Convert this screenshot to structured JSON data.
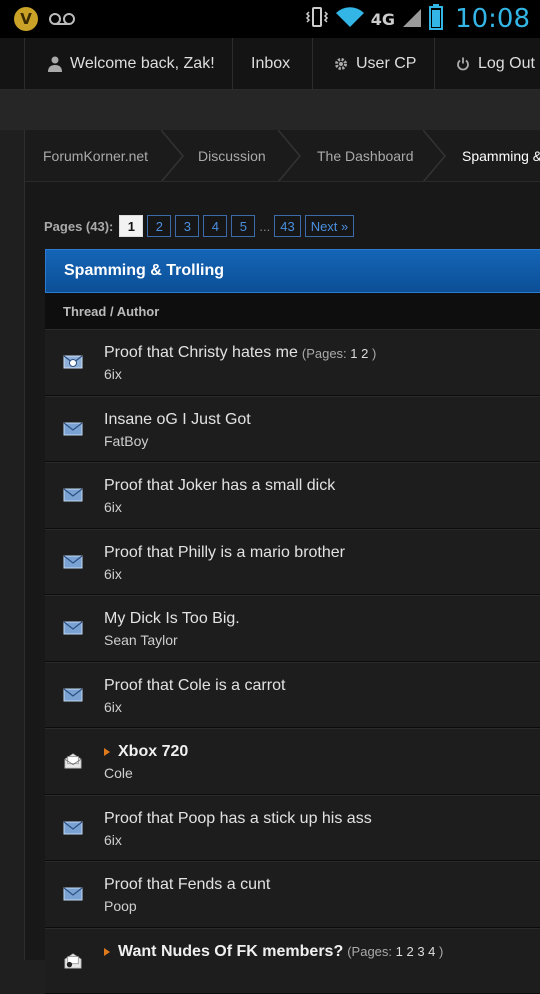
{
  "status_bar": {
    "time": "10:08",
    "network": "4G",
    "icons": [
      "verizon-icon",
      "voicemail-icon",
      "vibrate-icon",
      "wifi-icon",
      "signal-icon",
      "battery-icon"
    ]
  },
  "user_bar": {
    "welcome": "Welcome back, Zak!",
    "inbox": "Inbox",
    "user_cp": "User CP",
    "logout": "Log Out"
  },
  "breadcrumb": [
    "ForumKorner.net",
    "Discussion",
    "The Dashboard",
    "Spamming &"
  ],
  "pagination": {
    "label": "Pages (43):",
    "current": "1",
    "pages": [
      "2",
      "3",
      "4",
      "5"
    ],
    "ellipsis": "...",
    "last": "43",
    "next": "Next »"
  },
  "forum": {
    "title": "Spamming & Trolling",
    "column_header": "Thread / Author"
  },
  "threads": [
    {
      "title": "Proof that Christy hates me",
      "pages_label": "(Pages:",
      "pages": "1 2",
      "pages_close": ")",
      "author": "6ix",
      "icon": "hot-thread-icon",
      "sticky": false
    },
    {
      "title": "Insane oG I Just Got",
      "author": "FatBoy",
      "icon": "envelope-icon",
      "sticky": false
    },
    {
      "title": "Proof that Joker has a small dick",
      "author": "6ix",
      "icon": "envelope-icon",
      "sticky": false
    },
    {
      "title": "Proof that Philly is a mario brother",
      "author": "6ix",
      "icon": "envelope-icon",
      "sticky": false
    },
    {
      "title": "My Dick Is Too Big.",
      "author": "Sean Taylor",
      "icon": "envelope-icon",
      "sticky": false
    },
    {
      "title": "Proof that Cole is a carrot",
      "author": "6ix",
      "icon": "envelope-icon",
      "sticky": false
    },
    {
      "title": "Xbox 720",
      "author": "Cole",
      "icon": "open-envelope-icon",
      "sticky": true
    },
    {
      "title": "Proof that Poop has a stick up his ass",
      "author": "6ix",
      "icon": "envelope-icon",
      "sticky": false
    },
    {
      "title": "Proof that Fends a cunt",
      "author": "Poop",
      "icon": "envelope-icon",
      "sticky": false
    },
    {
      "title": "Want Nudes Of FK members?",
      "pages_label": "(Pages:",
      "pages": "1 2 3 4",
      "pages_close": ")",
      "author": "",
      "icon": "hot-folder-icon",
      "sticky": true
    }
  ],
  "colors": {
    "accent_blue": "#0b4f96",
    "link_blue": "#4a8fdf",
    "clock_blue": "#33b5e5",
    "sticky_marker": "#e07a1d"
  }
}
